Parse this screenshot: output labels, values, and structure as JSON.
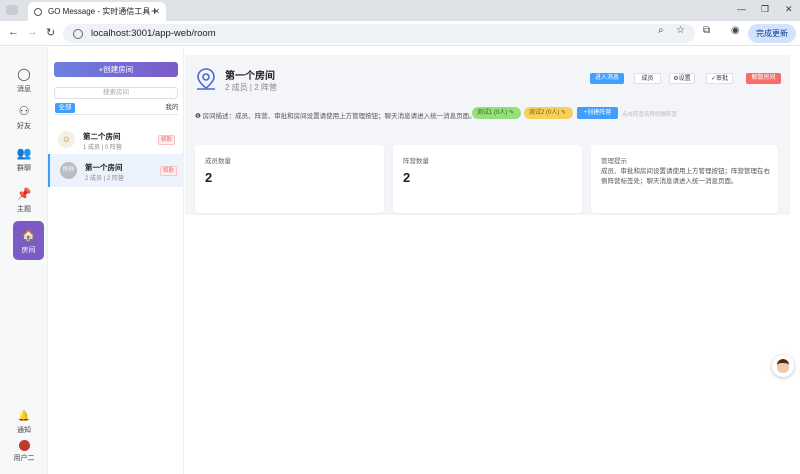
{
  "browser": {
    "tab_title": "GO Message - 实时通信工具",
    "url": "localhost:3001/app-web/room",
    "update_label": "完成更新"
  },
  "rail": {
    "items": [
      {
        "label": "消息",
        "icon": "chat-icon"
      },
      {
        "label": "好友",
        "icon": "person-icon"
      },
      {
        "label": "群聊",
        "icon": "group-icon"
      },
      {
        "label": "主题",
        "icon": "pin-icon"
      },
      {
        "label": "房间",
        "icon": "house-icon"
      }
    ],
    "notify_label": "通知",
    "user_label": "用户二"
  },
  "list": {
    "create_label": "+创建房间",
    "search_placeholder": "搜索房间",
    "filter_all": "全部",
    "filter_mine": "我的",
    "rooms": [
      {
        "name": "第二个房间",
        "meta": "1 成员 | 0 阵营",
        "tag": "解散"
      },
      {
        "name": "第一个房间",
        "meta": "2 成员 | 2 阵营",
        "tag": "解散",
        "avatar_text": "房间"
      }
    ]
  },
  "room": {
    "title": "第一个房间",
    "subtitle": "2 成员 | 2 阵营",
    "actions": {
      "enter": "进入消息",
      "members": "成员",
      "settings": "⚙设置",
      "approve": "✓审批",
      "dissolve": "解散房间"
    },
    "description": "房间描述：成员、阵营、审批和房间设置请使用上方管理按钮；聊天消息请进入统一消息页面。",
    "camps": [
      {
        "label": "测试1 (0人)"
      },
      {
        "label": "测试2 (0人)"
      }
    ],
    "create_camp": "+创建阵营",
    "drag_hint": "点击阵营名称切换阵营",
    "cards": [
      {
        "label": "成员数量",
        "value": "2"
      },
      {
        "label": "阵营数量",
        "value": "2"
      },
      {
        "label": "管理提示",
        "text": "成员、审批和房间设置请使用上方管理按钮；阵营管理在右侧阵营标签处；聊天消息请进入统一消息页面。"
      }
    ]
  },
  "colors": {
    "primary": "#409eff",
    "danger": "#f56c6c",
    "rail_active": "#7c5cc4"
  }
}
